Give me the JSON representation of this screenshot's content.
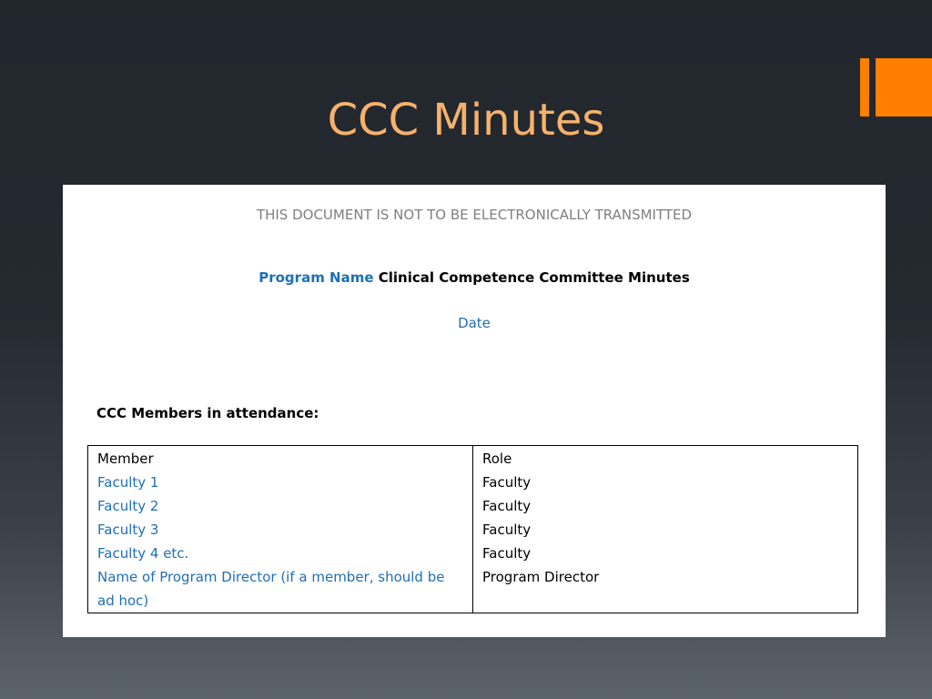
{
  "slide": {
    "title": "CCC Minutes",
    "title_color": "#f6b26b",
    "accent_color": "#ff8000"
  },
  "document": {
    "notice": "THIS DOCUMENT IS NOT TO BE ELECTRONICALLY TRANSMITTED",
    "program_name": "Program Name",
    "title_rest": "Clinical Competence Committee Minutes",
    "date": "Date",
    "section_heading": "CCC Members in attendance:",
    "table": {
      "headers": [
        "Member",
        "Role"
      ],
      "rows": [
        [
          "Faculty 1",
          "Faculty"
        ],
        [
          "Faculty 2",
          "Faculty"
        ],
        [
          "Faculty 3",
          "Faculty"
        ],
        [
          "Faculty 4 etc.",
          "Faculty"
        ],
        [
          "Name of Program Director (if a member, should be ad hoc)",
          "Program Director"
        ]
      ]
    },
    "link_color": "#1f6fb5"
  }
}
